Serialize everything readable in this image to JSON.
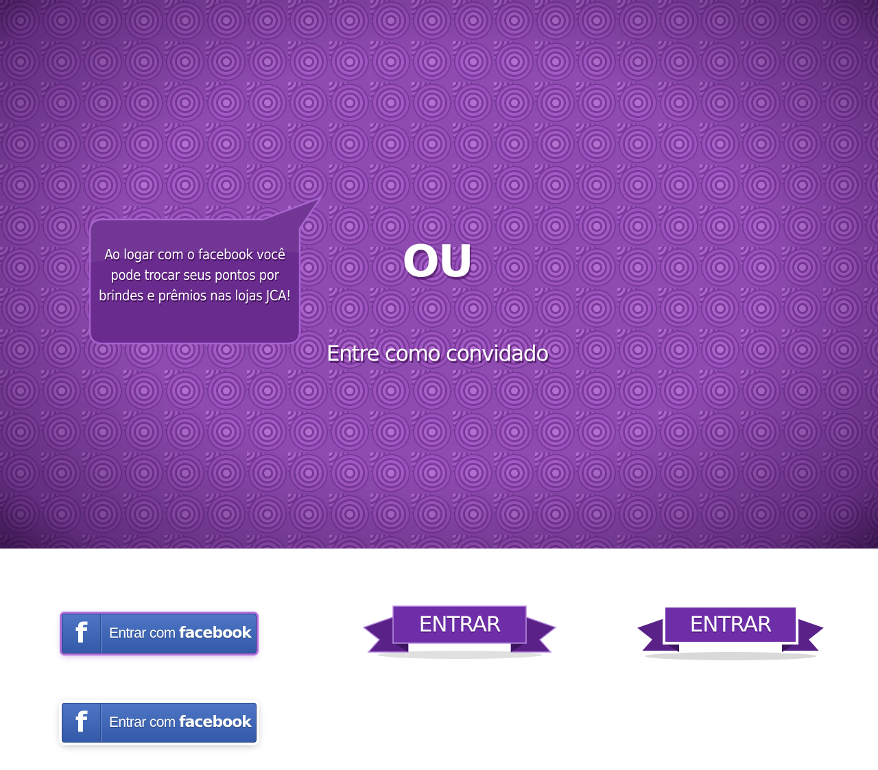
{
  "login_screen": {
    "info_bubble": {
      "text": "Ao logar com o facebook você pode trocar seus pontos por brindes e prêmios nas lojas JCA!"
    },
    "or_label": "OU",
    "guest_link": "Entre como convidado"
  },
  "assets": {
    "facebook_button": {
      "prefix": "Entrar com ",
      "brand": "facebook",
      "icon": "facebook-f-icon"
    },
    "enter_button": {
      "label": "ENTRAR"
    }
  },
  "colors": {
    "background_purple": "#8e4bb0",
    "ribbon_purple": "#6e2ea8",
    "ribbon_tail_purple": "#5a2288",
    "facebook_blue": "#3b5db0"
  }
}
